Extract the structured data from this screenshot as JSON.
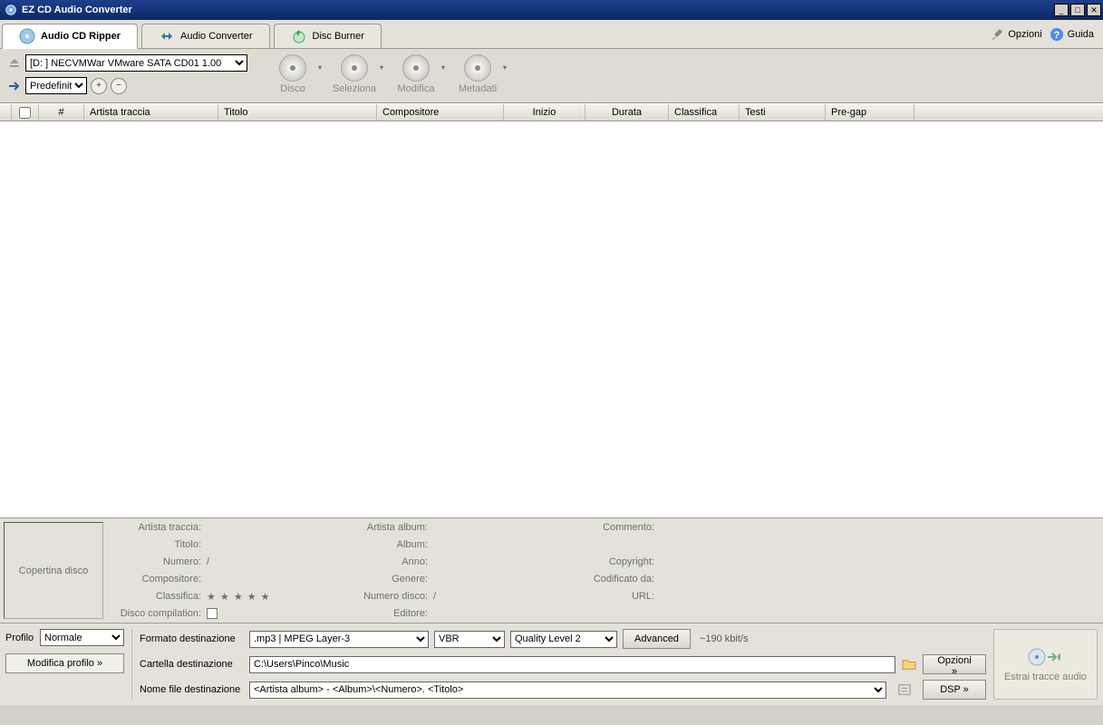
{
  "window": {
    "title": "EZ CD Audio Converter"
  },
  "tabs": {
    "ripper": "Audio CD Ripper",
    "converter": "Audio Converter",
    "burner": "Disc Burner"
  },
  "topright": {
    "opzioni": "Opzioni",
    "guida": "Guida"
  },
  "drive": {
    "selected": "[D: ] NECVMWar VMware SATA CD01 1.00",
    "preset": "Predefinita"
  },
  "actions": {
    "disco": "Disco",
    "seleziona": "Seleziona",
    "modifica": "Modifica",
    "metadati": "Metadati"
  },
  "columns": {
    "num": "#",
    "artist": "Artista traccia",
    "title": "Titolo",
    "composer": "Compositore",
    "start": "Inizio",
    "duration": "Durata",
    "rank": "Classifica",
    "lyrics": "Testi",
    "pregap": "Pre-gap"
  },
  "cover_label": "Copertina disco",
  "meta": {
    "artist_track": "Artista traccia:",
    "title": "Titolo:",
    "number": "Numero:",
    "number_val": "/",
    "composer": "Compositore:",
    "rank": "Classifica:",
    "compilation": "Disco compilation:",
    "artist_album": "Artista album:",
    "album": "Album:",
    "year": "Anno:",
    "genre": "Genere:",
    "disc_num": "Numero disco:",
    "disc_num_val": "/",
    "editor": "Editore:",
    "comment": "Commento:",
    "copyright": "Copyright:",
    "encoded_by": "Codificato da:",
    "url": "URL:"
  },
  "profile": {
    "label": "Profilo",
    "value": "Normale",
    "modify": "Modifica profilo »"
  },
  "format": {
    "label": "Formato destinazione",
    "codec": ".mp3 | MPEG Layer-3",
    "mode": "VBR",
    "quality": "Quality Level 2",
    "advanced": "Advanced",
    "bitrate": "~190 kbit/s"
  },
  "folder": {
    "label": "Cartella destinazione",
    "value": "C:\\Users\\Pinco\\Music",
    "opzioni": "Opzioni »"
  },
  "filename": {
    "label": "Nome file destinazione",
    "value": "<Artista album> - <Album>\\<Numero>. <Titolo>",
    "dsp": "DSP »"
  },
  "extract": {
    "label": "Estrai tracce audio"
  }
}
